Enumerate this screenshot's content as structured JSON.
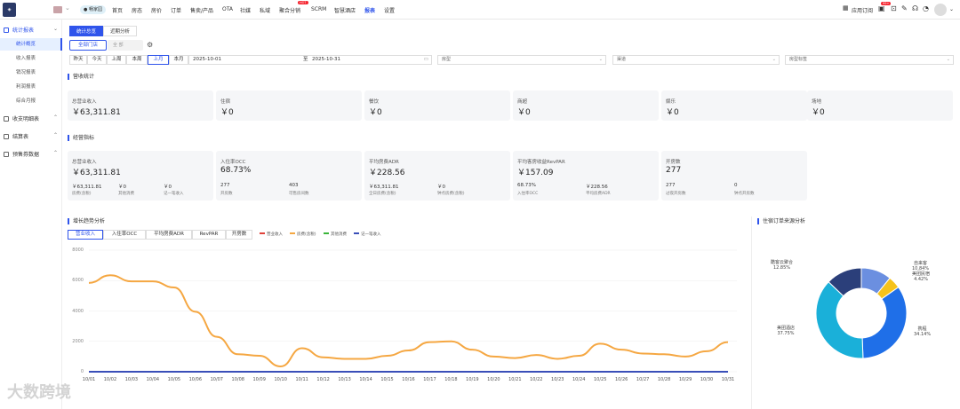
{
  "topnav": {
    "hotel_pill": "畅家园",
    "items": [
      "首页",
      "房态",
      "房价",
      "订单",
      "售卖/产品",
      "OTA",
      "社媒",
      "私域",
      "聚合分销",
      "SCRM",
      "智慧酒店",
      "报表",
      "设置"
    ],
    "hot_badge": "HOT",
    "app_center": "应用订阅",
    "msg_badge": "99+"
  },
  "sidebar": {
    "groups": [
      {
        "label": "统计报表",
        "items": [
          "统计概览",
          "收入报表",
          "销况报表",
          "利润报表",
          "综合月报"
        ]
      },
      {
        "label": "收支明细表"
      },
      {
        "label": "结算表"
      },
      {
        "label": "预售券数据"
      }
    ]
  },
  "tabs": [
    "统计总览",
    "近期分析"
  ],
  "store": {
    "label": "全部门店",
    "selected": "全 部"
  },
  "datefilter": {
    "buttons": [
      "昨天",
      "今天",
      "上周",
      "本周",
      "上月",
      "本月"
    ],
    "start": "2025-10-01",
    "sep": "至",
    "end": "2025-10-31",
    "selects": [
      "房型",
      "渠道",
      "房型标签"
    ]
  },
  "revenue": {
    "title": "营收统计",
    "cards": [
      {
        "label": "总营业收入",
        "value": "￥63,311.81"
      },
      {
        "label": "住宿",
        "value": "￥0"
      },
      {
        "label": "餐饮",
        "value": "￥0"
      },
      {
        "label": "商超",
        "value": "￥0"
      },
      {
        "label": "娱乐",
        "value": "￥0"
      },
      {
        "label": "场地",
        "value": "￥0"
      }
    ]
  },
  "ops": {
    "title": "经营指标",
    "cards": [
      {
        "label": "总营业收入",
        "value": "￥63,311.81",
        "subs": [
          {
            "v": "￥63,311.81",
            "l": "房费(含税)"
          },
          {
            "v": "￥0",
            "l": "其他消费"
          },
          {
            "v": "￥0",
            "l": "记一笔收入"
          }
        ]
      },
      {
        "label": "入住率OCC",
        "value": "68.73%",
        "subs": [
          {
            "v": "277",
            "l": "开房数"
          },
          {
            "v": "403",
            "l": "可售房间数"
          }
        ]
      },
      {
        "label": "平均房费ADR",
        "value": "￥228.56",
        "subs": [
          {
            "v": "￥63,311.81",
            "l": "全日房费(含税)"
          },
          {
            "v": "￥0",
            "l": "钟点房费(含税)"
          }
        ]
      },
      {
        "label": "平均客房收益RevPAR",
        "value": "￥157.09",
        "subs": [
          {
            "v": "68.73%",
            "l": "入住率OCC"
          },
          {
            "v": "￥228.56",
            "l": "平均房费ADR"
          }
        ]
      },
      {
        "label": "开房数",
        "value": "277",
        "subs": [
          {
            "v": "277",
            "l": "过夜开房数"
          },
          {
            "v": "0",
            "l": "钟点开房数"
          }
        ]
      }
    ]
  },
  "trend": {
    "title": "增长趋势分析",
    "tabs": [
      "营业收入",
      "入住率OCC",
      "平均房费ADR",
      "RevPAR",
      "开房数"
    ],
    "legend": [
      {
        "name": "营业收入",
        "color": "#e0413a"
      },
      {
        "name": "房费(含税)",
        "color": "#f5a742"
      },
      {
        "name": "其他消费",
        "color": "#3ab53a"
      },
      {
        "name": "记一笔收入",
        "color": "#3a4fb8"
      }
    ]
  },
  "chart_data": [
    {
      "type": "line",
      "categories": [
        "10/01",
        "10/02",
        "10/03",
        "10/04",
        "10/05",
        "10/06",
        "10/07",
        "10/08",
        "10/09",
        "10/10",
        "10/11",
        "10/12",
        "10/13",
        "10/14",
        "10/15",
        "10/16",
        "10/17",
        "10/18",
        "10/19",
        "10/20",
        "10/21",
        "10/22",
        "10/23",
        "10/24",
        "10/25",
        "10/26",
        "10/27",
        "10/28",
        "10/29",
        "10/30",
        "10/31"
      ],
      "yticks": [
        0,
        2000,
        4000,
        6000,
        8000
      ],
      "ylim": [
        0,
        8000
      ],
      "series": [
        {
          "name": "房费(含税)",
          "color": "#f5a742",
          "values": [
            5850,
            6350,
            5950,
            5950,
            5550,
            3950,
            2300,
            1150,
            1050,
            350,
            1550,
            950,
            850,
            850,
            1050,
            1400,
            1950,
            2000,
            1450,
            1000,
            900,
            1100,
            850,
            1050,
            1850,
            1450,
            1200,
            1150,
            1000,
            1350,
            1950
          ]
        },
        {
          "name": "记一笔收入",
          "color": "#3a4fb8",
          "values": [
            0,
            0,
            0,
            0,
            0,
            0,
            0,
            0,
            0,
            0,
            0,
            0,
            0,
            0,
            0,
            0,
            0,
            0,
            0,
            0,
            0,
            0,
            0,
            0,
            0,
            0,
            0,
            0,
            0,
            0,
            0
          ]
        }
      ]
    },
    {
      "type": "pie",
      "title": "住宿订单来源分析",
      "slices": [
        {
          "name": "自来客",
          "value": 10.84,
          "color": "#6b8fe0"
        },
        {
          "name": "美团民宿",
          "value": 4.42,
          "color": "#f5c21b"
        },
        {
          "name": "携程",
          "value": 34.14,
          "color": "#1f6fe8"
        },
        {
          "name": "美团酒店",
          "value": 37.75,
          "color": "#1ab0d9"
        },
        {
          "name": "酷客云聚合",
          "value": 12.85,
          "color": "#2b3f7a"
        }
      ],
      "labels": [
        {
          "name": "自来客",
          "pct": "10.84%"
        },
        {
          "name": "美团民宿",
          "pct": "4.42%"
        },
        {
          "name": "携程",
          "pct": "34.14%"
        },
        {
          "name": "美团酒店",
          "pct": "37.75%"
        },
        {
          "name": "酷客云聚合",
          "pct": "12.85%"
        }
      ]
    }
  ],
  "watermark": "大数跨境"
}
